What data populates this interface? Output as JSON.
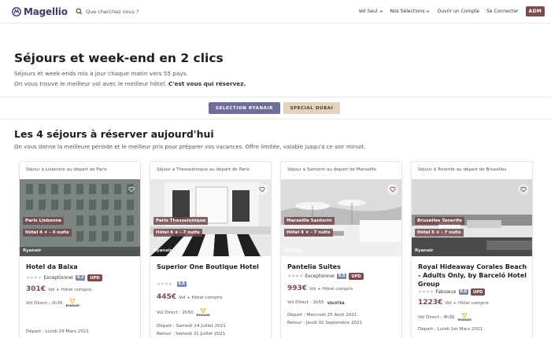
{
  "brand": {
    "name": "Magellio"
  },
  "search": {
    "placeholder": "Que cherchez vous ?"
  },
  "nav": {
    "vol_seul": "Vol Seul",
    "selections": "Nos Sélections",
    "ouvrir_compte": "Ouvrir un Compte",
    "connecter": "Se Connecter",
    "admin": "ADM"
  },
  "hero": {
    "title": "Séjours et week-end en 2 clics",
    "line1": "Séjours et week-ends mis à jour chaque matin vers 55 pays.",
    "line2_a": "On vous trouve le meilleur vol avec le meilleur hôtel.",
    "line2_b": "C'est vous qui réservez."
  },
  "pills": {
    "ryanair": "SELECTION RYANAIR",
    "dubai": "SPECIAL DUBAI"
  },
  "section": {
    "title": "Les 4 séjours à réserver aujourd'hui",
    "subtitle": "On vous donne la meilleure période et le meilleur prix pour préparer vos vacances. Offre limitée, valable jusqu'à ce soir minuit."
  },
  "colors": {
    "brand": "#3b3d6e",
    "accent": "#7b4b4d",
    "ryanair_pill": "#6f6d99",
    "dubai_pill": "#e2d2bf"
  },
  "cards": [
    {
      "header": "Séjour à Lisbonne au départ de Paris",
      "city_tag": "Paris Lisbonne",
      "hotel_tag": "Hôtel 4 ★ - 4 nuits",
      "airline": "Ryanair",
      "hotel_name": "Hotel da Baixa",
      "rating_word": "Exceptionnel",
      "score": "9.2",
      "badge": "UPD",
      "price": "301€",
      "price_note": "Vol + Hôtel compris",
      "vol": "Vol Direct : 2h30",
      "airline_logo": "RYANAIR",
      "depart": "Départ : Lundi 29 Mars 2021",
      "retour": ""
    },
    {
      "header": "Séjour à Thessalonique au départ de Paris",
      "city_tag": "Paris Thessalonique",
      "hotel_tag": "Hôtel 4 ★ - 7 nuits",
      "airline": "Ryanair",
      "hotel_name": "Superior One Boutique Hotel",
      "rating_word": "",
      "score": "8.6",
      "badge": "UPD",
      "price": "445€",
      "price_note": "Vol + Hôtel compris",
      "vol": "Vol Direct : 2h50",
      "airline_logo": "RYANAIR",
      "depart": "Départ : Samedi 24 Juillet 2021",
      "retour": "Retour : Samedi 31 Juillet 2021"
    },
    {
      "header": "Séjour à Santorin au départ de Marseille",
      "city_tag": "Marseille Santorin",
      "hotel_tag": "Hôtel 4 ★ - 7 nuits",
      "airline": "Volotea",
      "hotel_name": "Pantelia Suites",
      "rating_word": "Exceptionnel",
      "score": "9.5",
      "badge": "UPD",
      "price": "993€",
      "price_note": "Vol + Hôtel compris",
      "vol": "Vol Direct : 2h55",
      "airline_logo": "VOLOTEA",
      "depart": "Départ : Mercredi 25 Août 2021",
      "retour": "Retour : Jeudi 02 Septembre 2021"
    },
    {
      "header": "Séjour à Tenerife au départ de Bruxelles",
      "city_tag": "Bruxelles Tenerife",
      "hotel_tag": "Hôtel 5 ★ - 7 nuits",
      "airline": "Ryanair",
      "hotel_name": "Royal Hideaway Corales Beach - Adults Only, by Barceló Hotel Group",
      "rating_word": "Fabuleux",
      "score": "9.0",
      "badge": "UPD",
      "price": "1223€",
      "price_note": "Vol + Hôtel compris",
      "vol": "Vol Direct : 4h30",
      "airline_logo": "RYANAIR",
      "depart": "Départ : Lundi 1er Mars 2021",
      "retour": ""
    }
  ]
}
